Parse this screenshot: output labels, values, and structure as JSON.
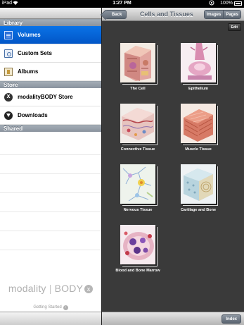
{
  "status_bar": {
    "carrier": "iPad",
    "time": "1:27 PM",
    "battery": "100%"
  },
  "sidebar": {
    "sections": [
      {
        "title": "Library",
        "items": [
          {
            "label": "Volumes",
            "icon": "volumes-icon",
            "selected": true
          },
          {
            "label": "Custom Sets",
            "icon": "custom-sets-icon",
            "selected": false
          },
          {
            "label": "Albums",
            "icon": "albums-icon",
            "selected": false
          }
        ]
      },
      {
        "title": "Store",
        "items": [
          {
            "label": "modalityBODY Store",
            "icon": "store-icon",
            "selected": false
          },
          {
            "label": "Downloads",
            "icon": "downloads-icon",
            "selected": false
          }
        ]
      },
      {
        "title": "Shared",
        "items": []
      }
    ],
    "logo": {
      "part1": "modality",
      "part2": "BODY"
    },
    "getting_started": "Getting Started"
  },
  "toolbar": {
    "back_label": "Back",
    "title": "Cells and Tissues",
    "segments": [
      "Images",
      "Pages"
    ],
    "edit_label": "Edit",
    "index_label": "Index"
  },
  "tiles": [
    {
      "label": "The Cell",
      "image": "cell-illustration"
    },
    {
      "label": "Epithelium",
      "image": "epithelium-illustration"
    },
    {
      "label": "Connective Tissue",
      "image": "connective-tissue-illustration"
    },
    {
      "label": "Muscle Tissue",
      "image": "muscle-tissue-illustration"
    },
    {
      "label": "Nervous Tissue",
      "image": "nervous-tissue-illustration"
    },
    {
      "label": "Cartilage and Bone",
      "image": "cartilage-bone-illustration"
    },
    {
      "label": "Blood and Bone Marrow",
      "image": "blood-marrow-illustration"
    }
  ],
  "colors": {
    "selected_row": "#0a73e7",
    "content_background": "#3a3a3a",
    "section_header": "#8a939e"
  }
}
